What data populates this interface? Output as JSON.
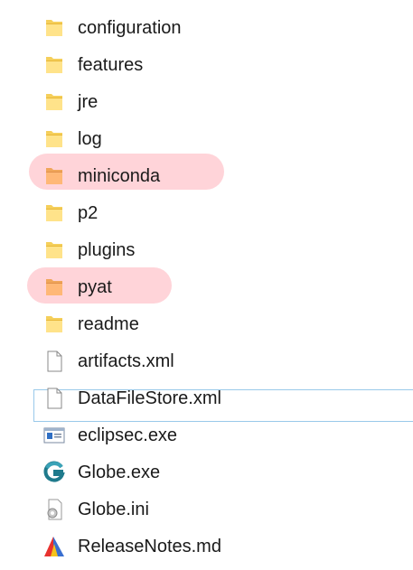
{
  "files": [
    {
      "name": "configuration",
      "type": "folder"
    },
    {
      "name": "features",
      "type": "folder"
    },
    {
      "name": "jre",
      "type": "folder"
    },
    {
      "name": "log",
      "type": "folder"
    },
    {
      "name": "miniconda",
      "type": "folder"
    },
    {
      "name": "p2",
      "type": "folder"
    },
    {
      "name": "plugins",
      "type": "folder"
    },
    {
      "name": "pyat",
      "type": "folder"
    },
    {
      "name": "readme",
      "type": "folder"
    },
    {
      "name": "artifacts.xml",
      "type": "document"
    },
    {
      "name": "DataFileStore.xml",
      "type": "document"
    },
    {
      "name": "eclipsec.exe",
      "type": "console-exe"
    },
    {
      "name": "Globe.exe",
      "type": "globe-exe"
    },
    {
      "name": "Globe.ini",
      "type": "settings-file"
    },
    {
      "name": "ReleaseNotes.md",
      "type": "markdown-file"
    }
  ],
  "highlighted": [
    "miniconda",
    "pyat"
  ],
  "focused": "DataFileStore.xml",
  "colors": {
    "folder_fill": "#FFE38A",
    "folder_highlighted_fill": "#FFB877",
    "highlight": "#FFA0AA",
    "focus_outline": "#99C9EA"
  }
}
